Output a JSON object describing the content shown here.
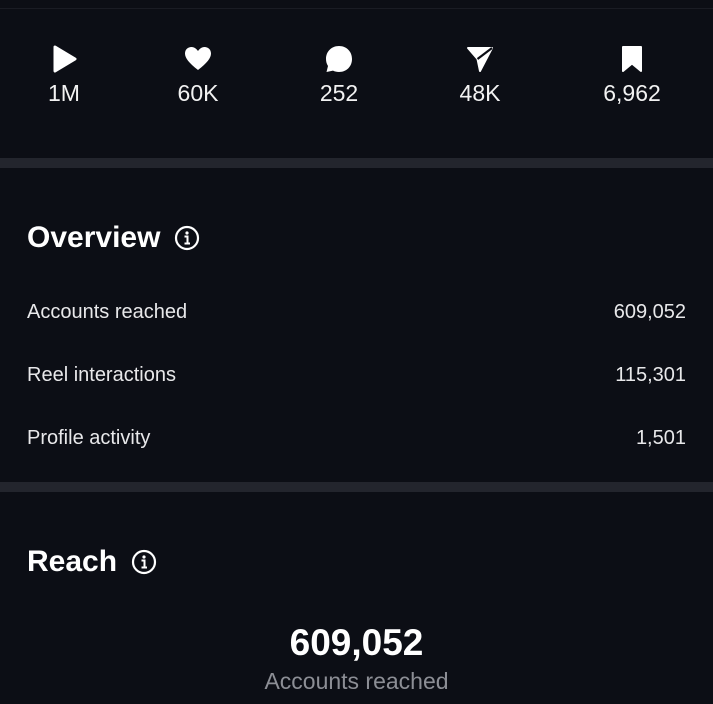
{
  "stats": [
    {
      "icon": "play-icon",
      "value": "1M"
    },
    {
      "icon": "heart-icon",
      "value": "60K"
    },
    {
      "icon": "comment-icon",
      "value": "252"
    },
    {
      "icon": "share-icon",
      "value": "48K"
    },
    {
      "icon": "bookmark-icon",
      "value": "6,962"
    }
  ],
  "overview": {
    "title": "Overview",
    "info_icon": "info-icon",
    "rows": [
      {
        "label": "Accounts reached",
        "value": "609,052"
      },
      {
        "label": "Reel interactions",
        "value": "115,301"
      },
      {
        "label": "Profile activity",
        "value": "1,501"
      }
    ]
  },
  "reach": {
    "title": "Reach",
    "info_icon": "info-icon",
    "big_value": "609,052",
    "big_label": "Accounts reached"
  },
  "colors": {
    "background": "#0c0e15",
    "divider": "#23252d",
    "text": "#ffffff",
    "muted": "#8c8e95"
  }
}
